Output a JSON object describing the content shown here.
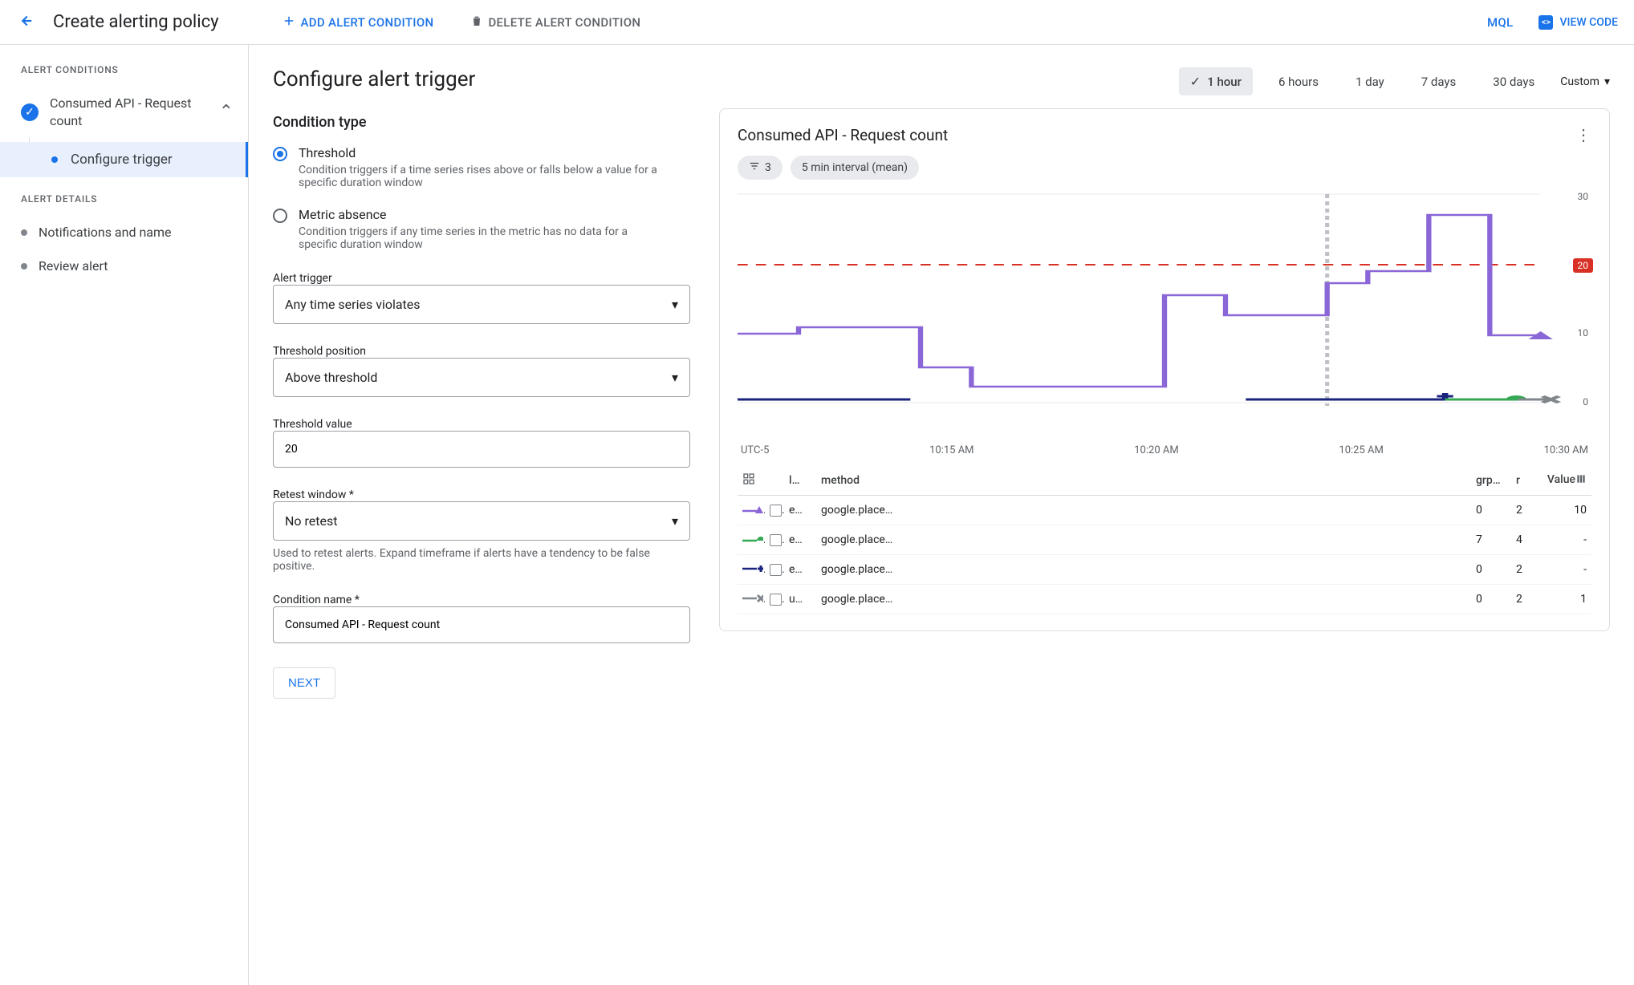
{
  "topbar": {
    "title": "Create alerting policy",
    "add_btn": "ADD ALERT CONDITION",
    "delete_btn": "DELETE ALERT CONDITION",
    "mql": "MQL",
    "view_code": "VIEW CODE"
  },
  "sidebar": {
    "sections": {
      "conditions": "ALERT CONDITIONS",
      "details": "ALERT DETAILS"
    },
    "condition_item": "Consumed API - Request count",
    "sub_item": "Configure trigger",
    "detail_items": [
      "Notifications and name",
      "Review alert"
    ]
  },
  "form": {
    "heading": "Configure alert trigger",
    "condition_type_heading": "Condition type",
    "options": {
      "threshold": {
        "label": "Threshold",
        "desc": "Condition triggers if a time series rises above or falls below a value for a specific duration window"
      },
      "absence": {
        "label": "Metric absence",
        "desc": "Condition triggers if any time series in the metric has no data for a specific duration window"
      }
    },
    "fields": {
      "alert_trigger": {
        "label": "Alert trigger",
        "value": "Any time series violates"
      },
      "threshold_position": {
        "label": "Threshold position",
        "value": "Above threshold"
      },
      "threshold_value": {
        "label": "Threshold value",
        "value": "20"
      },
      "retest_window": {
        "label": "Retest window *",
        "value": "No retest",
        "helper": "Used to retest alerts. Expand timeframe if alerts have a tendency to be false positive."
      },
      "condition_name": {
        "label": "Condition name *",
        "value": "Consumed API - Request count"
      }
    },
    "next": "NEXT"
  },
  "preview": {
    "time_options": [
      "1 hour",
      "6 hours",
      "1 day",
      "7 days",
      "30 days"
    ],
    "time_selected": "1 hour",
    "time_custom": "Custom",
    "card_title": "Consumed API - Request count",
    "filter_count": "3",
    "interval_pill": "5 min interval (mean)",
    "threshold_value": "20",
    "y_ticks": [
      "30",
      "20",
      "10",
      "0"
    ],
    "timezone": "UTC-5",
    "x_ticks": [
      "10:15 AM",
      "10:20 AM",
      "10:25 AM",
      "10:30 AM"
    ],
    "table": {
      "headers": {
        "loc": "l…",
        "method": "method",
        "grp": "grp…",
        "r": "r",
        "value": "Value"
      },
      "rows": [
        {
          "marker": "triangle",
          "color": "#8a66d7",
          "loc": "e…",
          "method": "google.place…",
          "grp": "0",
          "r": "2",
          "value": "10"
        },
        {
          "marker": "semi",
          "color": "#34a853",
          "loc": "e…",
          "method": "google.place…",
          "grp": "7",
          "r": "4",
          "value": "-"
        },
        {
          "marker": "plus",
          "color": "#1a237e",
          "loc": "e…",
          "method": "google.place…",
          "grp": "0",
          "r": "2",
          "value": "-"
        },
        {
          "marker": "x",
          "color": "#80868b",
          "loc": "u…",
          "method": "google.place…",
          "grp": "0",
          "r": "2",
          "value": "1"
        }
      ]
    }
  },
  "chart_data": {
    "type": "line",
    "title": "Consumed API - Request count",
    "ylim": [
      0,
      30
    ],
    "threshold": 20,
    "x": [
      "10:11",
      "10:12",
      "10:13",
      "10:14",
      "10:15",
      "10:16",
      "10:17",
      "10:18",
      "10:19",
      "10:20",
      "10:21",
      "10:22",
      "10:23",
      "10:24",
      "10:25",
      "10:26",
      "10:27",
      "10:28",
      "10:29",
      "10:30",
      "10:31"
    ],
    "series": [
      {
        "name": "google.place… (e)",
        "color": "#8a66d7",
        "values": [
          11,
          11,
          12,
          12,
          12,
          12,
          6,
          6,
          3,
          3,
          3,
          3,
          3,
          3,
          16,
          16,
          13,
          13,
          18,
          18,
          21,
          21,
          29,
          29,
          10
        ]
      },
      {
        "name": "google.place… (e)",
        "color": "#34a853",
        "values": [
          null,
          null,
          null,
          null,
          null,
          null,
          null,
          null,
          null,
          null,
          null,
          null,
          null,
          null,
          null,
          null,
          null,
          null,
          0,
          0,
          0,
          0,
          0
        ]
      },
      {
        "name": "google.place… (e)",
        "color": "#1a237e",
        "values": [
          0,
          0,
          0,
          0,
          0,
          0,
          null,
          null,
          null,
          null,
          null,
          null,
          null,
          null,
          null,
          null,
          0,
          0,
          0,
          0,
          0
        ]
      },
      {
        "name": "google.place… (u)",
        "color": "#80868b",
        "values": [
          null,
          null,
          null,
          null,
          null,
          null,
          null,
          null,
          null,
          null,
          null,
          null,
          null,
          null,
          null,
          null,
          null,
          null,
          null,
          null,
          0,
          0,
          0
        ]
      }
    ]
  }
}
